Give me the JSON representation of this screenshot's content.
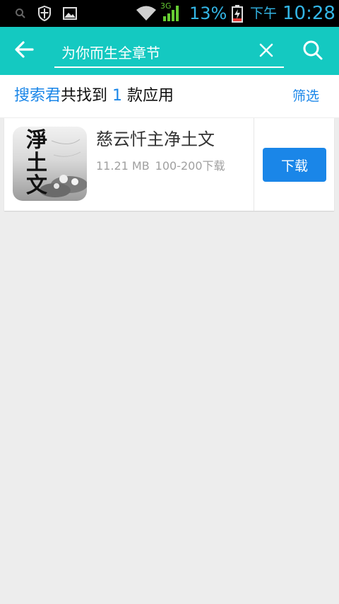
{
  "status_bar": {
    "network_type": "3G",
    "battery_percent": "13%",
    "period": "下午",
    "time": "10:28",
    "icons": [
      "search-icon",
      "shield-icon",
      "image-icon",
      "wifi-icon",
      "signal-icon",
      "battery-charging-icon"
    ],
    "accent_color": "#33b5e5"
  },
  "toolbar": {
    "background_color": "#14c9c1",
    "search_query": "为你而生全章节",
    "icons": [
      "back-arrow-icon",
      "clear-icon",
      "search-icon"
    ]
  },
  "results": {
    "prefix": "搜索君",
    "found_text": "共找到",
    "count": "1",
    "suffix": "款应用",
    "filter_label": "筛选"
  },
  "apps": [
    {
      "name": "慈云忏主净土文",
      "size": "11.21 MB",
      "downloads": "100-200下载",
      "icon_text": [
        "淨",
        "土",
        "文"
      ],
      "download_label": "下载",
      "button_color": "#1a86e8"
    }
  ]
}
